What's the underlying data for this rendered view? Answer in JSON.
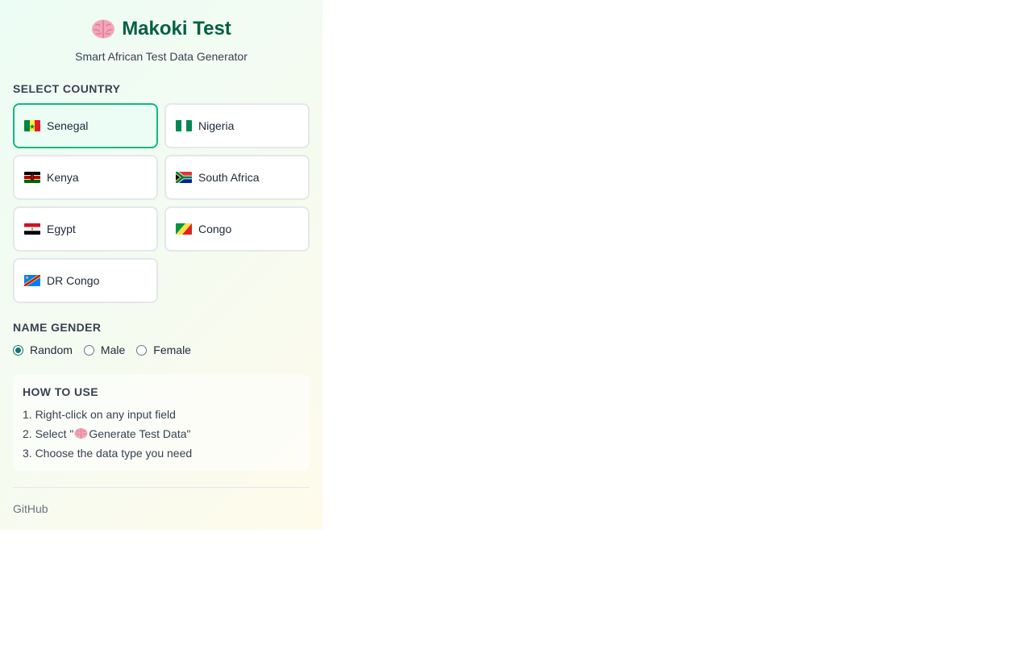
{
  "header": {
    "title": "Makoki Test",
    "subtitle": "Smart African Test Data Generator",
    "logo_icon": "brain-icon"
  },
  "country_section": {
    "label": "SELECT COUNTRY",
    "selected": "Senegal",
    "countries": [
      {
        "name": "Senegal",
        "flag": "flag-senegal-icon"
      },
      {
        "name": "Nigeria",
        "flag": "flag-nigeria-icon"
      },
      {
        "name": "Kenya",
        "flag": "flag-kenya-icon"
      },
      {
        "name": "South Africa",
        "flag": "flag-south-africa-icon"
      },
      {
        "name": "Egypt",
        "flag": "flag-egypt-icon"
      },
      {
        "name": "Congo",
        "flag": "flag-congo-icon"
      },
      {
        "name": "DR Congo",
        "flag": "flag-dr-congo-icon"
      }
    ]
  },
  "gender_section": {
    "label": "NAME GENDER",
    "selected": "Random",
    "options": [
      "Random",
      "Male",
      "Female"
    ]
  },
  "howto": {
    "title": "HOW TO USE",
    "step1": "1. Right-click on any input field",
    "step2_prefix": "2. Select \"",
    "step2_suffix": "Generate Test Data\"",
    "step3": "3. Choose the data type you need"
  },
  "footer": {
    "link": "GitHub"
  },
  "colors": {
    "accent": "#10b981",
    "title": "#065f46",
    "selected_bg": "#ecfdf5"
  }
}
